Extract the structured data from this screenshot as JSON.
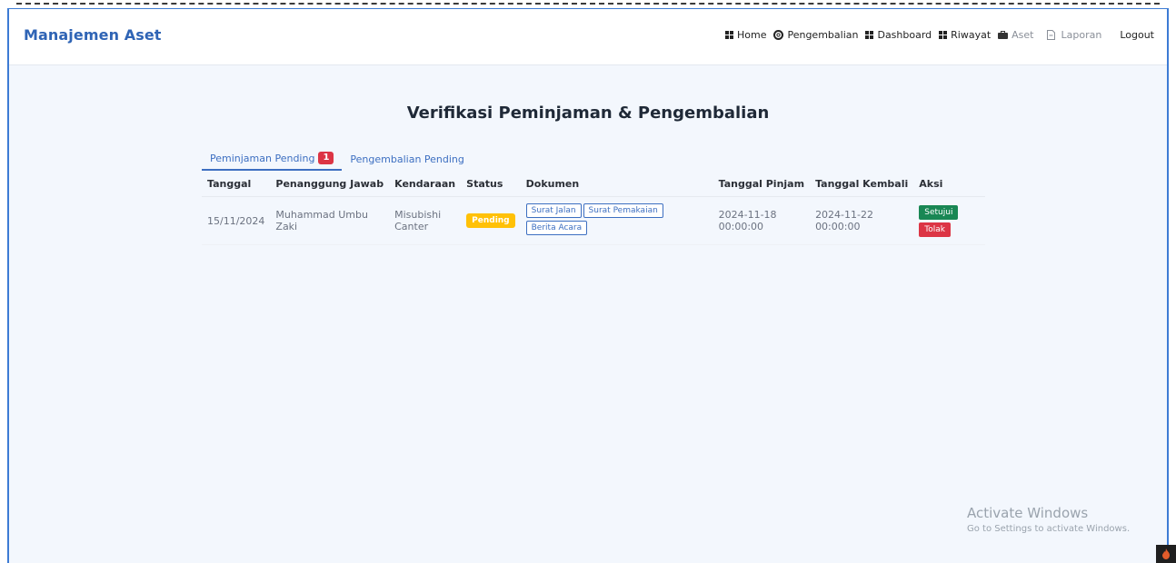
{
  "app": {
    "brand": "Manajemen Aset"
  },
  "nav": {
    "items": [
      {
        "label": "Home",
        "icon": "grid-icon"
      },
      {
        "label": "Pengembalian",
        "icon": "lifebuoy-icon"
      },
      {
        "label": "Dashboard",
        "icon": "grid-icon"
      },
      {
        "label": "Riwayat",
        "icon": "grid-icon"
      },
      {
        "label": "Aset",
        "icon": "briefcase-icon"
      },
      {
        "label": "Laporan",
        "icon": "file-icon"
      }
    ],
    "logout": "Logout"
  },
  "page": {
    "title": "Verifikasi Peminjaman & Pengembalian"
  },
  "tabs": [
    {
      "label": "Peminjaman Pending",
      "badge": "1",
      "active": true
    },
    {
      "label": "Pengembalian Pending",
      "active": false
    }
  ],
  "table": {
    "headers": [
      "Tanggal",
      "Penanggung Jawab",
      "Kendaraan",
      "Status",
      "Dokumen",
      "Tanggal Pinjam",
      "Tanggal Kembali",
      "Aksi"
    ],
    "rows": [
      {
        "tanggal": "15/11/2024",
        "penanggung_jawab": "Muhammad Umbu Zaki",
        "kendaraan": "Misubishi Canter",
        "status": "Pending",
        "dokumen": [
          "Surat Jalan",
          "Surat Pemakaian",
          "Berita Acara"
        ],
        "tanggal_pinjam": "2024-11-18 00:00:00",
        "tanggal_kembali": "2024-11-22 00:00:00",
        "aksi": {
          "approve": "Setujui",
          "reject": "Tolak"
        }
      }
    ]
  },
  "watermark": {
    "line1": "Activate Windows",
    "line2": "Go to Settings to activate Windows."
  },
  "colors": {
    "brand": "#2f64b5",
    "pending": "#ffc107",
    "approve": "#198754",
    "reject": "#dc3545"
  }
}
